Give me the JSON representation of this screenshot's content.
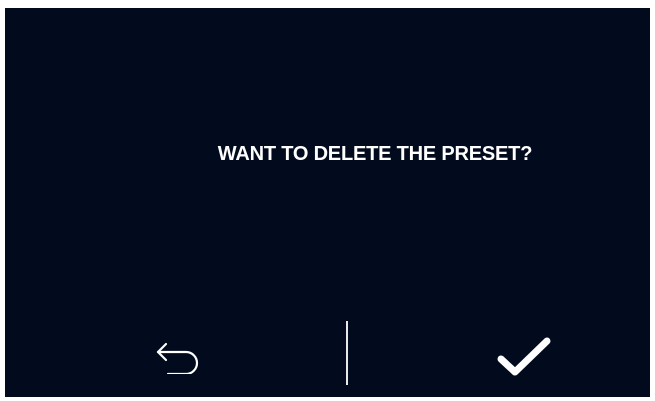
{
  "dialog": {
    "message": "WANT TO DELETE THE PRESET?"
  },
  "actions": {
    "back_icon": "back-arrow-icon",
    "confirm_icon": "checkmark-icon"
  },
  "colors": {
    "background": "#020b1d",
    "text": "#ffffff",
    "divider": "#e8e8e8"
  }
}
